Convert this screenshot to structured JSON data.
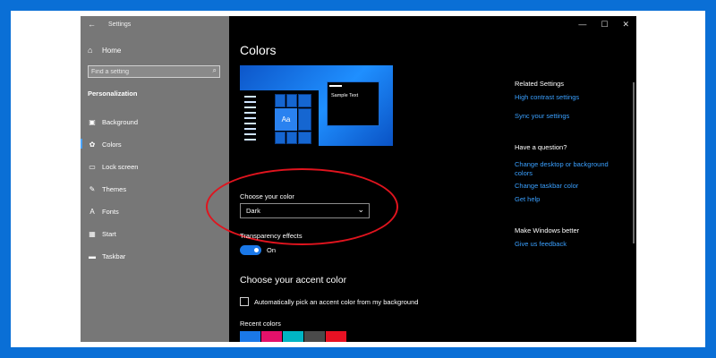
{
  "window": {
    "app_title": "Settings",
    "back_icon": "back-arrow-icon",
    "controls": [
      "—",
      "☐",
      "✕"
    ]
  },
  "sidebar": {
    "home_label": "Home",
    "search_placeholder": "Find a setting",
    "section_title": "Personalization",
    "items": [
      {
        "label": "Background",
        "icon": "picture-icon",
        "glyph": "▣"
      },
      {
        "label": "Colors",
        "icon": "palette-icon",
        "glyph": "✿",
        "active": true
      },
      {
        "label": "Lock screen",
        "icon": "lock-screen-icon",
        "glyph": "▭"
      },
      {
        "label": "Themes",
        "icon": "themes-icon",
        "glyph": "✎"
      },
      {
        "label": "Fonts",
        "icon": "fonts-icon",
        "glyph": "A"
      },
      {
        "label": "Start",
        "icon": "start-icon",
        "glyph": "▦"
      },
      {
        "label": "Taskbar",
        "icon": "taskbar-icon",
        "glyph": "▬"
      }
    ]
  },
  "main": {
    "page_title": "Colors",
    "preview": {
      "tile_text": "Aa",
      "sample_text": "Sample Text"
    },
    "choose_color_label": "Choose your color",
    "choose_color_value": "Dark",
    "transparency_label": "Transparency effects",
    "transparency_state": "On",
    "accent_title": "Choose your accent color",
    "auto_accent_label": "Automatically pick an accent color from my background",
    "recent_colors_label": "Recent colors",
    "recent_colors": [
      "#1a78e8",
      "#e3116a",
      "#00b4c4",
      "#4a4a4a",
      "#e81123"
    ]
  },
  "related": {
    "related_title": "Related Settings",
    "related_links": [
      "High contrast settings",
      "Sync your settings"
    ],
    "question_title": "Have a question?",
    "question_links": [
      "Change desktop or background colors",
      "Change taskbar color",
      "Get help"
    ],
    "better_title": "Make Windows better",
    "better_links": [
      "Give us feedback"
    ]
  },
  "colors": {
    "accent": "#1a78e8",
    "link": "#3aa0ff",
    "highlight_oval": "#e0141e",
    "page_background": "#0a6fd6"
  }
}
